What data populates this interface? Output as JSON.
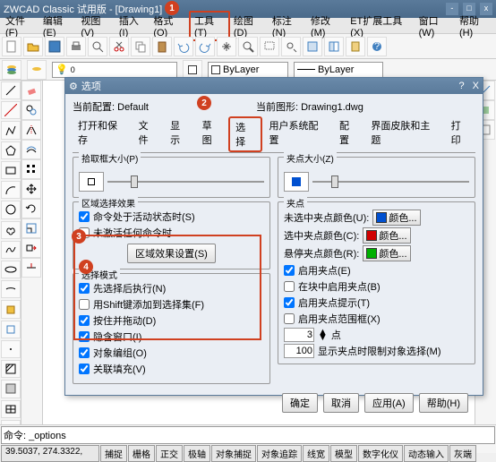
{
  "title": "ZWCAD Classic 试用版 - [Drawing1]",
  "menu": [
    "文件(F)",
    "编辑(E)",
    "视图(V)",
    "插入(I)",
    "格式(O)",
    "工具(T)",
    "绘图(D)",
    "标注(N)",
    "修改(M)",
    "ET扩展工具(X)",
    "窗口(W)",
    "帮助(H)"
  ],
  "layerbar": {
    "layer": "ByLayer",
    "prop": "ByLayer"
  },
  "dialog": {
    "title": "选项",
    "profile_lbl": "当前配置:",
    "profile": "Default",
    "drawing_lbl": "当前图形:",
    "drawing": "Drawing1.dwg",
    "tabs": [
      "打开和保存",
      "文件",
      "显示",
      "草图",
      "选择",
      "用户系统配置",
      "配置",
      "界面皮肤和主题",
      "打印"
    ],
    "pickbox_grp": "拾取框大小(P)",
    "grip_grp": "夹点大小(Z)",
    "region_grp": "区域选择效果",
    "region_c1": "命令处于活动状态时(S)",
    "region_c2": "未激活任何命令时",
    "region_btn": "区域效果设置(S)",
    "selmode_grp": "选择模式",
    "sm": [
      "先选择后执行(N)",
      "用Shift键添加到选择集(F)",
      "按住并拖动(D)",
      "隐含窗口(I)",
      "对象编组(O)",
      "关联填充(V)"
    ],
    "grips_grp": "夹点",
    "gc1": "未选中夹点颜色(U):",
    "gc2": "选中夹点颜色(C):",
    "gc3": "悬停夹点颜色(R):",
    "color_btn": "颜色...",
    "gchk": [
      "启用夹点(E)",
      "在块中启用夹点(B)",
      "启用夹点提示(T)",
      "启用夹点范围框(X)"
    ],
    "grip_limit_lbl": "显示夹点时限制对象选择(M)",
    "grip_spin_lbl": "点",
    "grip_spin": "3",
    "grip_limit": "100",
    "btns": [
      "确定",
      "取消",
      "应用(A)",
      "帮助(H)"
    ]
  },
  "cmd_prompt": "命令:",
  "cmd": "_options",
  "coords": "39.5037, 274.3322, ",
  "status": [
    "捕捉",
    "栅格",
    "正交",
    "极轴",
    "对象捕捉",
    "对象追踪",
    "线宽",
    "模型",
    "数字化仪",
    "动态输入",
    "灰端"
  ],
  "markers": [
    "1",
    "2",
    "3",
    "4"
  ]
}
